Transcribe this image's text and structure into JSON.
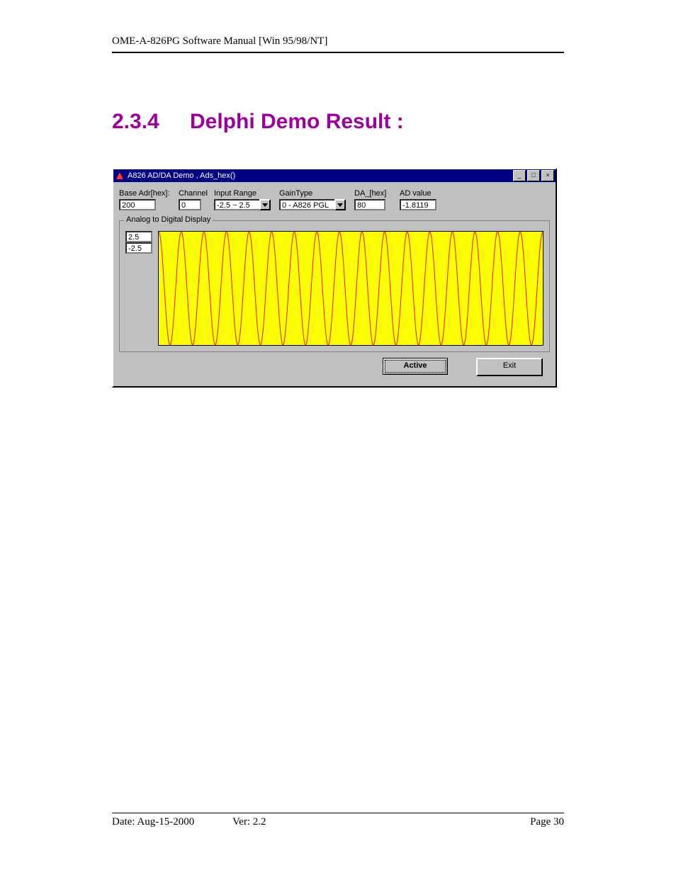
{
  "header": "OME-A-826PG Software Manual [Win 95/98/NT]",
  "section": {
    "number": "2.3.4",
    "title": "Delphi Demo Result :"
  },
  "window": {
    "title": "A826 AD/DA Demo , Ads_hex()",
    "fields": {
      "base_adr": {
        "label": "Base Adr[hex]:",
        "value": "200"
      },
      "channel": {
        "label": "Channel",
        "value": "0"
      },
      "input_range": {
        "label": "Input Range",
        "value": "-2.5 ~ 2.5"
      },
      "gain_type": {
        "label": "GainType",
        "value": "0 - A826 PGL"
      },
      "da_hex": {
        "label": "DA_[hex]",
        "value": "80"
      },
      "ad_value": {
        "label": "AD value",
        "value": "-1.8119"
      }
    },
    "group_title": "Analog to Digital Display",
    "axis": {
      "max": "2.5",
      "min": "-2.5"
    },
    "buttons": {
      "active": "Active",
      "exit": "Exit"
    }
  },
  "footer": {
    "date": "Date: Aug-15-2000",
    "ver": "Ver: 2.2",
    "page": "Page  30"
  },
  "chart_data": {
    "type": "line",
    "title": "Analog to Digital Display",
    "ylabel": "",
    "xlabel": "",
    "ylim": [
      -2.5,
      2.5
    ],
    "cycles": 17,
    "amplitude": 2.5,
    "samples": 560
  }
}
